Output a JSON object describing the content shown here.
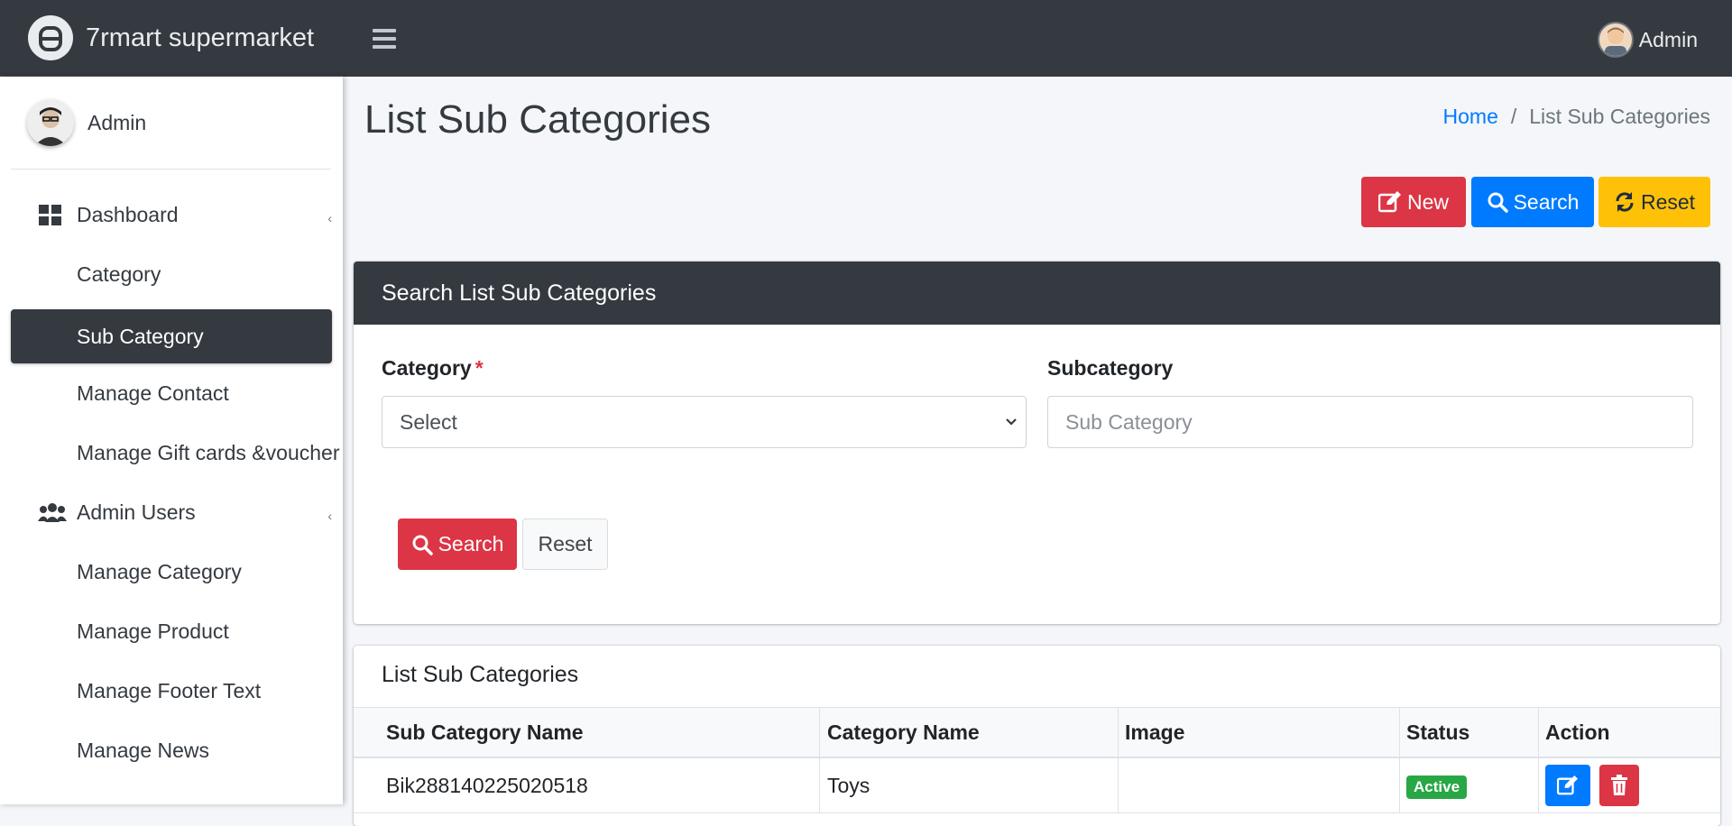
{
  "app": {
    "brand": "7rmart supermarket",
    "top_user": "Admin"
  },
  "sidebar": {
    "user_name": "Admin",
    "items": [
      {
        "label": "Dashboard",
        "icon": "dashboard-icon",
        "caret": "‹"
      },
      {
        "label": "Category"
      },
      {
        "label": "Sub Category",
        "active": true
      },
      {
        "label": "Manage Contact"
      },
      {
        "label": "Manage Gift cards &voucher"
      },
      {
        "label": "Admin Users",
        "icon": "users-icon",
        "caret": "‹"
      },
      {
        "label": "Manage Category"
      },
      {
        "label": "Manage Product"
      },
      {
        "label": "Manage Footer Text"
      },
      {
        "label": "Manage News"
      }
    ]
  },
  "page": {
    "title": "List Sub Categories",
    "breadcrumb": {
      "home": "Home",
      "sep": "/",
      "current": "List Sub Categories"
    }
  },
  "toolbar": {
    "new_label": "New",
    "search_label": "Search",
    "reset_label": "Reset"
  },
  "search_card": {
    "title": "Search List Sub Categories",
    "category_label": "Category",
    "required_mark": "*",
    "category_value": "Select",
    "subcategory_label": "Subcategory",
    "subcategory_placeholder": "Sub Category",
    "search_button": "Search",
    "reset_button": "Reset"
  },
  "list_card": {
    "title": "List Sub Categories",
    "columns": [
      "Sub Category Name",
      "Category Name",
      "Image",
      "Status",
      "Action"
    ],
    "rows": [
      {
        "sub_category": "Bik288140225020518",
        "category": "Toys",
        "image": "",
        "status": "Active"
      }
    ]
  },
  "colors": {
    "navbar": "#343a40",
    "primary": "#007bff",
    "danger": "#dc3545",
    "warning": "#ffc107",
    "success": "#28a745"
  }
}
